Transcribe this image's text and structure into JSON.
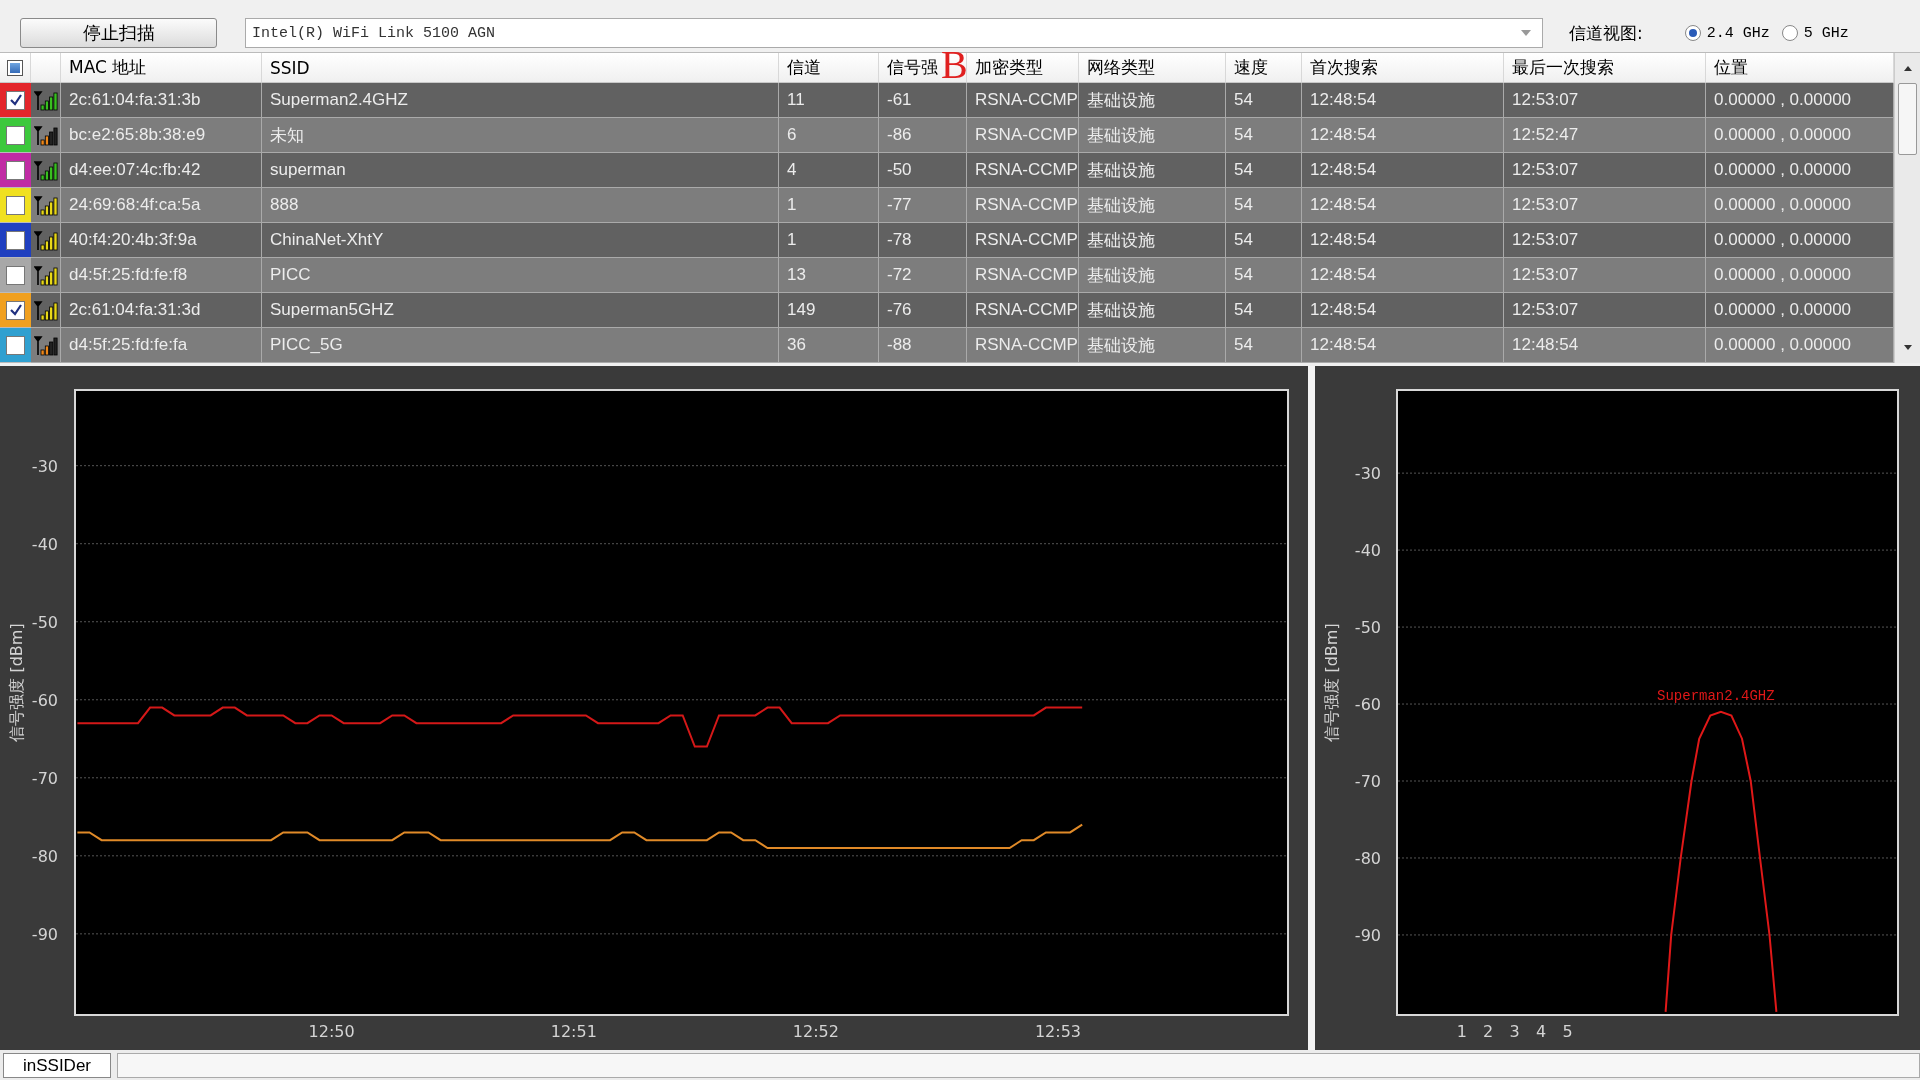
{
  "toolbar": {
    "stop_button": "停止扫描",
    "adapter": "Intel(R) WiFi Link 5100 AGN",
    "channel_view_label": "信道视图:",
    "bands": [
      {
        "label": "2.4 GHz",
        "selected": true
      },
      {
        "label": "5 GHz",
        "selected": false
      }
    ]
  },
  "table": {
    "select_all": {
      "indeterminate": true
    },
    "columns": [
      "MAC 地址",
      "SSID",
      "信道",
      "信号强",
      "加密类型",
      "网络类型",
      "速度",
      "首次搜索",
      "最后一次搜索",
      "位置"
    ],
    "annotation_mark": "B",
    "rows": [
      {
        "checked": true,
        "color": "#e3262b",
        "kind": "strong",
        "cells": [
          "2c:61:04:fa:31:3b",
          "Superman2.4GHZ",
          "11",
          "-61",
          "RSNA-CCMP",
          "基础设施",
          "54",
          "12:48:54",
          "12:53:07",
          "0.00000 , 0.00000"
        ]
      },
      {
        "checked": false,
        "color": "#3cc83c",
        "kind": "weak",
        "cells": [
          "bc:e2:65:8b:38:e9",
          "未知",
          "6",
          "-86",
          "RSNA-CCMP",
          "基础设施",
          "54",
          "12:48:54",
          "12:52:47",
          "0.00000 , 0.00000"
        ]
      },
      {
        "checked": false,
        "color": "#c02ca4",
        "kind": "strong",
        "cells": [
          "d4:ee:07:4c:fb:42",
          "superman",
          "4",
          "-50",
          "RSNA-CCMP",
          "基础设施",
          "54",
          "12:48:54",
          "12:53:07",
          "0.00000 , 0.00000"
        ]
      },
      {
        "checked": false,
        "color": "#f0e020",
        "kind": "medium",
        "cells": [
          "24:69:68:4f:ca:5a",
          "888",
          "1",
          "-77",
          "RSNA-CCMP",
          "基础设施",
          "54",
          "12:48:54",
          "12:53:07",
          "0.00000 , 0.00000"
        ]
      },
      {
        "checked": false,
        "color": "#2040c0",
        "kind": "medium",
        "cells": [
          "40:f4:20:4b:3f:9a",
          "ChinaNet-XhtY",
          "1",
          "-78",
          "RSNA-CCMP",
          "基础设施",
          "54",
          "12:48:54",
          "12:53:07",
          "0.00000 , 0.00000"
        ]
      },
      {
        "checked": false,
        "color": "#a8a8a8",
        "kind": "medium",
        "cells": [
          "d4:5f:25:fd:fe:f8",
          "PICC",
          "13",
          "-72",
          "RSNA-CCMP",
          "基础设施",
          "54",
          "12:48:54",
          "12:53:07",
          "0.00000 , 0.00000"
        ]
      },
      {
        "checked": true,
        "color": "#f0a020",
        "kind": "medium",
        "cells": [
          "2c:61:04:fa:31:3d",
          "Superman5GHZ",
          "149",
          "-76",
          "RSNA-CCMP",
          "基础设施",
          "54",
          "12:48:54",
          "12:53:07",
          "0.00000 , 0.00000"
        ]
      },
      {
        "checked": false,
        "color": "#30a0d0",
        "kind": "weak",
        "cells": [
          "d4:5f:25:fd:fe:fa",
          "PICC_5G",
          "36",
          "-88",
          "RSNA-CCMP",
          "基础设施",
          "54",
          "12:48:54",
          "12:48:54",
          "0.00000 , 0.00000"
        ]
      }
    ]
  },
  "time_graph": {
    "chart_data": {
      "type": "line",
      "grid": true,
      "ylabel": "信号强度 [dBm]",
      "categories": [
        null,
        null,
        null,
        null,
        null,
        null,
        null,
        null,
        null,
        null,
        null,
        null,
        null,
        null,
        null,
        null,
        null,
        null,
        null,
        null,
        null,
        "12:50",
        null,
        null,
        null,
        null,
        null,
        null,
        null,
        null,
        null,
        null,
        null,
        null,
        null,
        null,
        null,
        null,
        null,
        null,
        null,
        "12:51",
        null,
        null,
        null,
        null,
        null,
        null,
        null,
        null,
        null,
        null,
        null,
        null,
        null,
        null,
        null,
        null,
        null,
        null,
        null,
        "12:52",
        null,
        null,
        null,
        null,
        null,
        null,
        null,
        null,
        null,
        null,
        null,
        null,
        null,
        null,
        null,
        null,
        null,
        null,
        null,
        "12:53",
        null,
        null
      ],
      "series": [
        {
          "color": "#d41818",
          "values": [
            -63,
            -63,
            -63,
            -63,
            -63,
            -63,
            -61,
            -61,
            -62,
            -62,
            -62,
            -62,
            -61,
            -61,
            -62,
            -62,
            -62,
            -62,
            -63,
            -63,
            -62,
            -62,
            -63,
            -63,
            -63,
            -63,
            -62,
            -62,
            -63,
            -63,
            -63,
            -63,
            -63,
            -63,
            -63,
            -63,
            -62,
            -62,
            -62,
            -62,
            -62,
            -62,
            -62,
            -63,
            -63,
            -63,
            -63,
            -63,
            -63,
            -62,
            -62,
            -66,
            -66,
            -62,
            -62,
            -62,
            -62,
            -61,
            -61,
            -63,
            -63,
            -63,
            -63,
            -62,
            -62,
            -62,
            -62,
            -62,
            -62,
            -62,
            -62,
            -62,
            -62,
            -62,
            -62,
            -62,
            -62,
            -62,
            -62,
            -62,
            -61,
            -61,
            -61,
            -61
          ]
        },
        {
          "color": "#e08a28",
          "values": [
            -77,
            -77,
            -78,
            -78,
            -78,
            -78,
            -78,
            -78,
            -78,
            -78,
            -78,
            -78,
            -78,
            -78,
            -78,
            -78,
            -78,
            -77,
            -77,
            -77,
            -78,
            -78,
            -78,
            -78,
            -78,
            -78,
            -78,
            -77,
            -77,
            -77,
            -78,
            -78,
            -78,
            -78,
            -78,
            -78,
            -78,
            -78,
            -78,
            -78,
            -78,
            -78,
            -78,
            -78,
            -78,
            -77,
            -77,
            -78,
            -78,
            -78,
            -78,
            -78,
            -78,
            -77,
            -77,
            -78,
            -78,
            -79,
            -79,
            -79,
            -79,
            -79,
            -79,
            -79,
            -79,
            -79,
            -79,
            -79,
            -79,
            -79,
            -79,
            -79,
            -79,
            -79,
            -79,
            -79,
            -79,
            -79,
            -78,
            -78,
            -77,
            -77,
            -77,
            -76
          ]
        }
      ],
      "ylim": [
        -100.4,
        -20.3
      ],
      "yticks": [
        -30,
        -40,
        -50,
        -60,
        -70,
        -80,
        -90
      ]
    }
  },
  "channel_graph": {
    "chart_data": {
      "type": "line",
      "grid": true,
      "ylabel": "信号强度 [dBm]",
      "x": [
        8.71,
        8.92,
        9.28,
        9.69,
        9.98,
        10.4,
        10.8,
        11.2,
        11.6,
        11.93,
        12.28,
        12.64,
        12.9
      ],
      "series": [
        {
          "name": "Superman2.4GHZ",
          "color": "#e01818",
          "values": [
            -100,
            -90,
            -80,
            -70,
            -64.5,
            -61.5,
            -61,
            -61.5,
            -64.5,
            -70,
            -80,
            -90,
            -100
          ]
        }
      ],
      "xlim": [
        -1.45,
        17.5
      ],
      "ylim": [
        -100.4,
        -19.2
      ],
      "xticks": [
        1,
        2,
        3,
        4,
        5
      ],
      "yticks": [
        -30,
        -40,
        -50,
        -60,
        -70,
        -80,
        -90
      ]
    }
  },
  "status_bar": {
    "tab": "inSSIDer"
  }
}
